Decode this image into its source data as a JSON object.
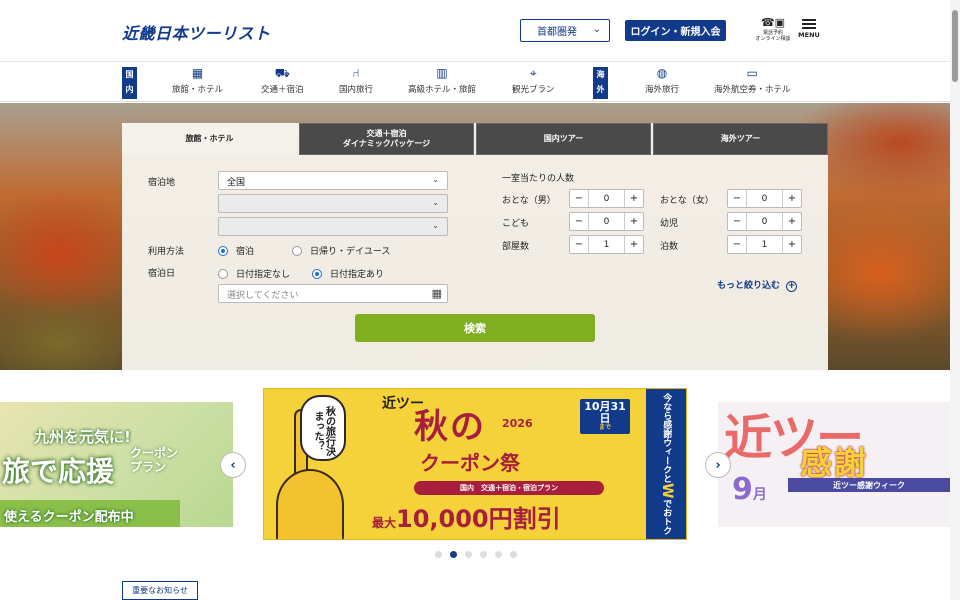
{
  "header": {
    "logo": "近畿日本ツーリスト",
    "region": "首都圏発",
    "login": "ログイン・新規入会",
    "phone_line1": "電話予約",
    "phone_line2": "オンライン相談",
    "menu": "MENU"
  },
  "nav": {
    "domestic_tag": "国内",
    "overseas_tag": "海外",
    "items": [
      {
        "label": "旅館・ホテル",
        "icon": "hotel-icon"
      },
      {
        "label": "交通＋宿泊",
        "icon": "train-icon"
      },
      {
        "label": "国内旅行",
        "icon": "chair-icon"
      },
      {
        "label": "高級ホテル・旅館",
        "icon": "building-icon"
      },
      {
        "label": "観光プラン",
        "icon": "map-icon"
      },
      {
        "label": "海外旅行",
        "icon": "globe-icon"
      },
      {
        "label": "海外航空券・ホテル",
        "icon": "ticket-icon"
      }
    ]
  },
  "search": {
    "tabs": [
      {
        "label": "旅館・ホテル",
        "sub": ""
      },
      {
        "label": "交通＋宿泊",
        "sub": "ダイナミックパッケージ"
      },
      {
        "label": "国内ツアー",
        "sub": ""
      },
      {
        "label": "海外ツアー",
        "sub": ""
      }
    ],
    "destination_label": "宿泊地",
    "destination_value": "全国",
    "usage_label": "利用方法",
    "usage_options": [
      "宿泊",
      "日帰り・デイユース"
    ],
    "date_label": "宿泊日",
    "date_options": [
      "日付指定なし",
      "日付指定あり"
    ],
    "date_placeholder": "選択してください",
    "people_title": "一室当たりの人数",
    "counters": [
      {
        "label": "おとな（男）",
        "value": "0"
      },
      {
        "label": "おとな（女）",
        "value": "0"
      },
      {
        "label": "こども",
        "value": "0"
      },
      {
        "label": "幼児",
        "value": "0"
      },
      {
        "label": "部屋数",
        "value": "1"
      },
      {
        "label": "泊数",
        "value": "1"
      }
    ],
    "more": "もっと絞り込む",
    "submit": "検索"
  },
  "banners": {
    "left": {
      "line1": "九州を元気に!",
      "line2": "旅で応援",
      "line3": "クーポン\nプラン",
      "line4": "使えるクーポン配布中"
    },
    "main": {
      "bubble": "秋の旅行決まった？",
      "brand": "近ツー",
      "title": "秋の",
      "year": "2026",
      "subtitle": "クーポン祭",
      "date": "10月31日",
      "date_sub": "まで",
      "pill": "国内　交通＋宿泊・宿泊プラン",
      "price_prefix": "最大",
      "price": "10,000円割引",
      "side_text": "今なら感謝ウィークと",
      "side_w": "W",
      "side_text2": "でおトク"
    },
    "right": {
      "bg": "近ツー",
      "kansha": "感謝",
      "band": "近ツー感謝ウィーク",
      "month": "9",
      "month_unit": "月"
    }
  },
  "carousel": {
    "prev": "‹",
    "next": "›",
    "dot_count": 6,
    "active": 1
  },
  "notice": "重要なお知らせ",
  "colors": {
    "brand": "#123a8a",
    "accent": "#7fae1e",
    "coupon_red": "#a81f3e",
    "coupon_yellow": "#f6d23a"
  }
}
